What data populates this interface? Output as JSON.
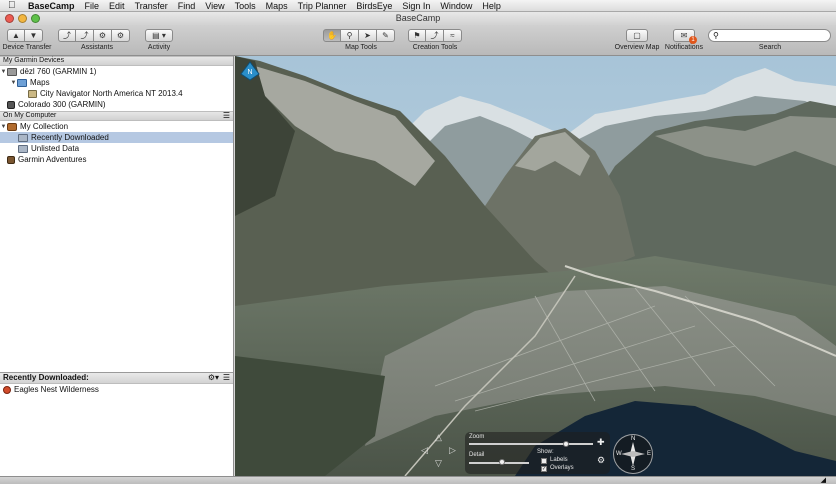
{
  "menubar": {
    "app_name": "BaseCamp",
    "items": [
      "File",
      "Edit",
      "Transfer",
      "Find",
      "View",
      "Tools",
      "Maps",
      "Trip Planner",
      "BirdsEye",
      "Sign In",
      "Window",
      "Help"
    ]
  },
  "window": {
    "title": "BaseCamp"
  },
  "toolbar": {
    "groups": {
      "device_transfer": "Device Transfer",
      "assistants": "Assistants",
      "activity": "Activity",
      "map_tools": "Map Tools",
      "creation_tools": "Creation Tools",
      "overview_map": "Overview Map",
      "notifications": "Notifications",
      "search": "Search"
    },
    "notification_count": "1",
    "search_placeholder": ""
  },
  "sidebar": {
    "garmin_devices_header": "My Garmin Devices",
    "device_1": "dēzl 760 (GARMIN 1)",
    "device_1_maps": "Maps",
    "device_1_map_item": "City Navigator North America NT 2013.4",
    "device_2": "Colorado 300 (GARMIN)",
    "computer_header": "On My Computer",
    "my_collection": "My Collection",
    "recently_downloaded": "Recently Downloaded",
    "unlisted_data": "Unlisted Data",
    "garmin_adventures": "Garmin Adventures"
  },
  "lower_pane": {
    "header": "Recently Downloaded:",
    "items": [
      "Eagles Nest Wilderness"
    ]
  },
  "map_controls": {
    "zoom_label": "Zoom",
    "detail_label": "Detail",
    "show_label": "Show:",
    "labels_label": "Labels",
    "overlays_label": "Overlays",
    "labels_checked": false,
    "overlays_checked": true,
    "compass": {
      "n": "N",
      "s": "S",
      "e": "E",
      "w": "W"
    },
    "north_badge": "N"
  },
  "colors": {
    "sky": "#a9c6d9",
    "mountain_dark": "#4d5a4f",
    "mountain_light": "#a8aaa4",
    "water": "#15283a",
    "selection": "#b5c8e2"
  }
}
